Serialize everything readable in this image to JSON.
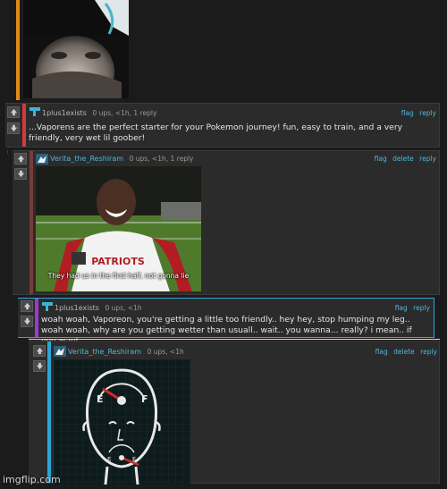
{
  "colors": {
    "accent": "#4fb6dc",
    "bg": "#1b1b1b",
    "comment_bg": "#2b2b2b",
    "border_orange": "#e08a1a",
    "border_red": "#d23b3b",
    "border_purple": "#9b3ad1",
    "border_blue": "#2da6d8"
  },
  "comments": [
    {
      "user": "1plus1exists",
      "info": "0 ups, <1h, 1 reply",
      "actions": [
        "flag",
        "reply"
      ],
      "text": "...Vaporens are the perfect starter for your Pokemon journey! fun, easy to train, and a very friendly, very wet lil goober!"
    },
    {
      "user": "Verita_the_Reshiram",
      "info": "0 ups, <1h, 1 reply",
      "actions": [
        "flag",
        "delete",
        "reply"
      ],
      "image_caption": "They had us in the first half, not gonna lie"
    },
    {
      "user": "1plus1exists",
      "info": "0 ups, <1h",
      "actions": [
        "flag",
        "reply"
      ],
      "text": "woah woah, Vaporeon, you're getting a little too friendly.. hey hey, stop humping my leg.. woah woah, why are you getting wetter than usuall.. wait.. you wanna... really? i mean.. if you want..."
    },
    {
      "user": "Verita_the_Reshiram",
      "info": "0 ups, <1h",
      "actions": [
        "flag",
        "delete",
        "reply"
      ]
    }
  ],
  "gauge": {
    "empty_label": "E",
    "full_label": "F"
  },
  "watermark": "imgflip.com"
}
